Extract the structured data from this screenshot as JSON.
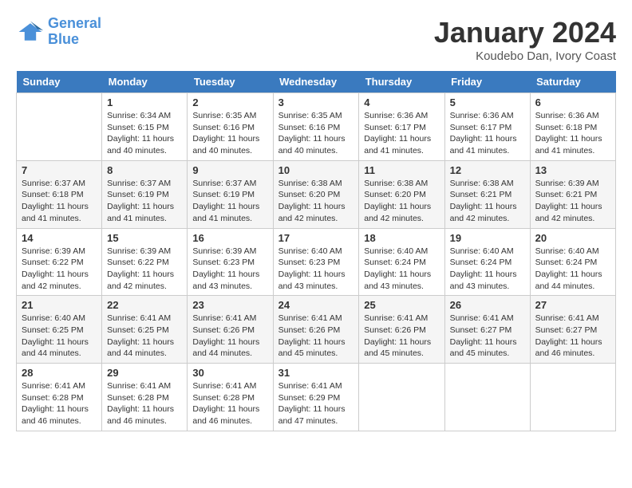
{
  "header": {
    "logo_line1": "General",
    "logo_line2": "Blue",
    "month_title": "January 2024",
    "location": "Koudebo Dan, Ivory Coast"
  },
  "weekdays": [
    "Sunday",
    "Monday",
    "Tuesday",
    "Wednesday",
    "Thursday",
    "Friday",
    "Saturday"
  ],
  "weeks": [
    [
      {
        "day": "",
        "info": ""
      },
      {
        "day": "1",
        "info": "Sunrise: 6:34 AM\nSunset: 6:15 PM\nDaylight: 11 hours\nand 40 minutes."
      },
      {
        "day": "2",
        "info": "Sunrise: 6:35 AM\nSunset: 6:16 PM\nDaylight: 11 hours\nand 40 minutes."
      },
      {
        "day": "3",
        "info": "Sunrise: 6:35 AM\nSunset: 6:16 PM\nDaylight: 11 hours\nand 40 minutes."
      },
      {
        "day": "4",
        "info": "Sunrise: 6:36 AM\nSunset: 6:17 PM\nDaylight: 11 hours\nand 41 minutes."
      },
      {
        "day": "5",
        "info": "Sunrise: 6:36 AM\nSunset: 6:17 PM\nDaylight: 11 hours\nand 41 minutes."
      },
      {
        "day": "6",
        "info": "Sunrise: 6:36 AM\nSunset: 6:18 PM\nDaylight: 11 hours\nand 41 minutes."
      }
    ],
    [
      {
        "day": "7",
        "info": "Sunrise: 6:37 AM\nSunset: 6:18 PM\nDaylight: 11 hours\nand 41 minutes."
      },
      {
        "day": "8",
        "info": "Sunrise: 6:37 AM\nSunset: 6:19 PM\nDaylight: 11 hours\nand 41 minutes."
      },
      {
        "day": "9",
        "info": "Sunrise: 6:37 AM\nSunset: 6:19 PM\nDaylight: 11 hours\nand 41 minutes."
      },
      {
        "day": "10",
        "info": "Sunrise: 6:38 AM\nSunset: 6:20 PM\nDaylight: 11 hours\nand 42 minutes."
      },
      {
        "day": "11",
        "info": "Sunrise: 6:38 AM\nSunset: 6:20 PM\nDaylight: 11 hours\nand 42 minutes."
      },
      {
        "day": "12",
        "info": "Sunrise: 6:38 AM\nSunset: 6:21 PM\nDaylight: 11 hours\nand 42 minutes."
      },
      {
        "day": "13",
        "info": "Sunrise: 6:39 AM\nSunset: 6:21 PM\nDaylight: 11 hours\nand 42 minutes."
      }
    ],
    [
      {
        "day": "14",
        "info": "Sunrise: 6:39 AM\nSunset: 6:22 PM\nDaylight: 11 hours\nand 42 minutes."
      },
      {
        "day": "15",
        "info": "Sunrise: 6:39 AM\nSunset: 6:22 PM\nDaylight: 11 hours\nand 42 minutes."
      },
      {
        "day": "16",
        "info": "Sunrise: 6:39 AM\nSunset: 6:23 PM\nDaylight: 11 hours\nand 43 minutes."
      },
      {
        "day": "17",
        "info": "Sunrise: 6:40 AM\nSunset: 6:23 PM\nDaylight: 11 hours\nand 43 minutes."
      },
      {
        "day": "18",
        "info": "Sunrise: 6:40 AM\nSunset: 6:24 PM\nDaylight: 11 hours\nand 43 minutes."
      },
      {
        "day": "19",
        "info": "Sunrise: 6:40 AM\nSunset: 6:24 PM\nDaylight: 11 hours\nand 43 minutes."
      },
      {
        "day": "20",
        "info": "Sunrise: 6:40 AM\nSunset: 6:24 PM\nDaylight: 11 hours\nand 44 minutes."
      }
    ],
    [
      {
        "day": "21",
        "info": "Sunrise: 6:40 AM\nSunset: 6:25 PM\nDaylight: 11 hours\nand 44 minutes."
      },
      {
        "day": "22",
        "info": "Sunrise: 6:41 AM\nSunset: 6:25 PM\nDaylight: 11 hours\nand 44 minutes."
      },
      {
        "day": "23",
        "info": "Sunrise: 6:41 AM\nSunset: 6:26 PM\nDaylight: 11 hours\nand 44 minutes."
      },
      {
        "day": "24",
        "info": "Sunrise: 6:41 AM\nSunset: 6:26 PM\nDaylight: 11 hours\nand 45 minutes."
      },
      {
        "day": "25",
        "info": "Sunrise: 6:41 AM\nSunset: 6:26 PM\nDaylight: 11 hours\nand 45 minutes."
      },
      {
        "day": "26",
        "info": "Sunrise: 6:41 AM\nSunset: 6:27 PM\nDaylight: 11 hours\nand 45 minutes."
      },
      {
        "day": "27",
        "info": "Sunrise: 6:41 AM\nSunset: 6:27 PM\nDaylight: 11 hours\nand 46 minutes."
      }
    ],
    [
      {
        "day": "28",
        "info": "Sunrise: 6:41 AM\nSunset: 6:28 PM\nDaylight: 11 hours\nand 46 minutes."
      },
      {
        "day": "29",
        "info": "Sunrise: 6:41 AM\nSunset: 6:28 PM\nDaylight: 11 hours\nand 46 minutes."
      },
      {
        "day": "30",
        "info": "Sunrise: 6:41 AM\nSunset: 6:28 PM\nDaylight: 11 hours\nand 46 minutes."
      },
      {
        "day": "31",
        "info": "Sunrise: 6:41 AM\nSunset: 6:29 PM\nDaylight: 11 hours\nand 47 minutes."
      },
      {
        "day": "",
        "info": ""
      },
      {
        "day": "",
        "info": ""
      },
      {
        "day": "",
        "info": ""
      }
    ]
  ]
}
